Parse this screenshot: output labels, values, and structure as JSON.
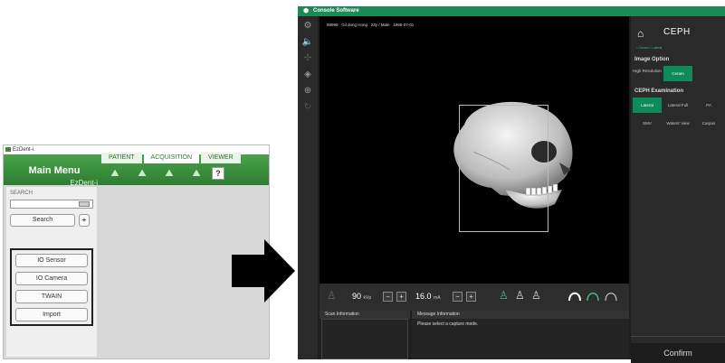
{
  "ezdent": {
    "window_title": "EzDent-i",
    "main_menu": "Main Menu",
    "brand": "EzDent-i",
    "tabs": [
      "PATIENT",
      "ACQUISITION",
      "VIEWER"
    ],
    "active_tab": "ACQUISITION",
    "help": "?",
    "search_label": "SEARCH",
    "search_value": "",
    "search_button": "Search",
    "plus_button": "+",
    "devices": [
      "IO Sensor",
      "IO Camera",
      "TWAIN",
      "Import"
    ]
  },
  "console": {
    "window_title": "Console Software",
    "patient_info": "99999   Gil dong Hong   23y / Male   1985-07-01",
    "controls": {
      "kvp_value": "90",
      "kvp_unit": "kVp",
      "ma_value": "16.0",
      "ma_unit": "mA",
      "minus": "−",
      "plus": "+"
    },
    "scan_info_label": "Scan Information",
    "message_label": "Message Information",
    "message_text": "Please select a capture mode.",
    "right_panel": {
      "title": "CEPH",
      "breadcrumb": "< Ceram > Lateral",
      "image_option_label": "Image Option",
      "image_options": [
        "High Resolution",
        "Ceram"
      ],
      "selected_image_option": "Ceram",
      "exam_label": "CEPH Examination",
      "exams_row1": [
        "Lateral",
        "Lateral Full",
        "PA"
      ],
      "exams_row2": [
        "SMV",
        "Waters' view",
        "Carpus"
      ],
      "selected_exam": "Lateral",
      "confirm": "Confirm"
    },
    "colors": {
      "accent": "#1a8a56",
      "button_green": "#0f8a5a",
      "figure_green": "#3fbf7f"
    }
  }
}
